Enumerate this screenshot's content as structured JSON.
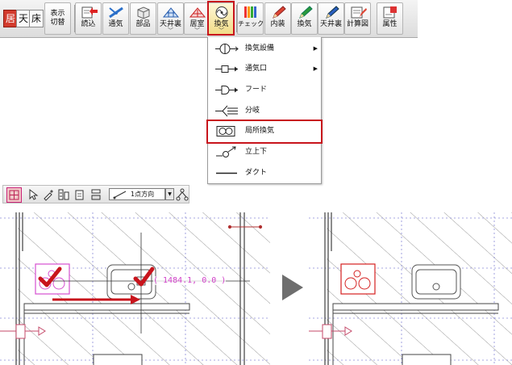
{
  "ribbon": {
    "view_buttons": [
      "居",
      "天",
      "床"
    ],
    "display_toggle": [
      "表示",
      "切替"
    ],
    "buttons": [
      {
        "label": "読込",
        "icon": "import-icon",
        "dropdown": false
      },
      {
        "label": "通気",
        "icon": "ventilation-icon",
        "dropdown": false
      },
      {
        "label": "部品",
        "icon": "parts-icon",
        "dropdown": false
      },
      {
        "label": "天井裏",
        "icon": "ceiling-cavity-icon",
        "dropdown": true
      },
      {
        "label": "居室",
        "icon": "living-room-icon",
        "dropdown": true
      },
      {
        "label": "換気",
        "icon": "exhaust-fan-icon",
        "dropdown": true
      },
      {
        "label": "チェック",
        "icon": "check-icon",
        "dropdown": false
      },
      {
        "label": "内装",
        "icon": "interior-icon",
        "dropdown": false
      },
      {
        "label": "換気",
        "icon": "ventilation-pencil-icon",
        "dropdown": false
      },
      {
        "label": "天井裏",
        "icon": "ceiling-pencil-icon",
        "dropdown": false
      },
      {
        "label": "計算図",
        "icon": "calc-diagram-icon",
        "dropdown": false
      },
      {
        "label": "属性",
        "icon": "attribute-icon",
        "dropdown": false
      }
    ],
    "dropdown_caret": "﹀"
  },
  "menu": {
    "items": [
      {
        "label": "換気設備",
        "icon": "ventilation-equipment-icon",
        "submenu": true
      },
      {
        "label": "通気口",
        "icon": "vent-opening-icon",
        "submenu": true
      },
      {
        "label": "フード",
        "icon": "hood-icon",
        "submenu": false
      },
      {
        "label": "分岐",
        "icon": "branch-icon",
        "submenu": false
      },
      {
        "label": "局所換気",
        "icon": "local-ventilation-icon",
        "submenu": false,
        "highlighted": true
      },
      {
        "label": "立上下",
        "icon": "riser-icon",
        "submenu": false
      },
      {
        "label": "ダクト",
        "icon": "duct-icon",
        "submenu": false
      }
    ],
    "submenu_arrow": "▶"
  },
  "subbar": {
    "mode_label": "1点方向",
    "mode_caret": "▼"
  },
  "canvas": {
    "coordinate_readout": "( 1484.1, 0.0 )",
    "colors": {
      "hatch": "#9a9a9a",
      "grid": "#8a8ad8",
      "wall": "#404040",
      "fixture_preview": "#d64fd0",
      "fixture_placed": "#d42020",
      "checkmark": "#c8141c",
      "highlight": "#c8141c"
    }
  }
}
